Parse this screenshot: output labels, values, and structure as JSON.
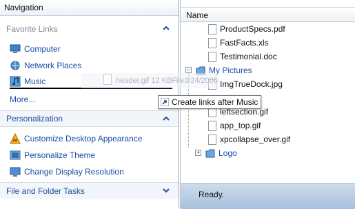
{
  "navigation": {
    "title": "Navigation",
    "favorite_links": {
      "title": "Favorite Links",
      "items": [
        {
          "label": "Computer",
          "icon": "computer-icon"
        },
        {
          "label": "Network Places",
          "icon": "network-icon"
        },
        {
          "label": "Music",
          "icon": "music-icon"
        }
      ],
      "more_label": "More..."
    },
    "personalization": {
      "title": "Personalization",
      "items": [
        {
          "label": "Customize Desktop Appearance",
          "icon": "appearance-icon"
        },
        {
          "label": "Personalize Theme",
          "icon": "theme-icon"
        },
        {
          "label": "Change Display Resolution",
          "icon": "display-icon"
        }
      ]
    },
    "tasks": {
      "title": "File and Folder Tasks"
    }
  },
  "files": {
    "column_header": "Name",
    "items": [
      {
        "name": "ProductSpecs.pdf",
        "type": "file"
      },
      {
        "name": "FastFacts.xls",
        "type": "file"
      },
      {
        "name": "Testimonial.doc",
        "type": "file"
      },
      {
        "name": "My Pictures",
        "type": "folder",
        "expanded": true
      },
      {
        "name": "ImgTrueDock.jpg",
        "type": "file"
      },
      {
        "name": "leftsection.gif",
        "type": "file"
      },
      {
        "name": "app_top.gif",
        "type": "file"
      },
      {
        "name": "xpcollapse_over.gif",
        "type": "file"
      },
      {
        "name": "Logo",
        "type": "folder",
        "expanded": false
      }
    ],
    "status": "Ready."
  },
  "drag": {
    "ghost_text": "header.gif 12 KBFile3/24/2006",
    "tooltip": "Create links after Music"
  },
  "colors": {
    "link": "#1a4ea6",
    "status_bar": "#b9cde4",
    "muted_header": "#7a8794"
  }
}
